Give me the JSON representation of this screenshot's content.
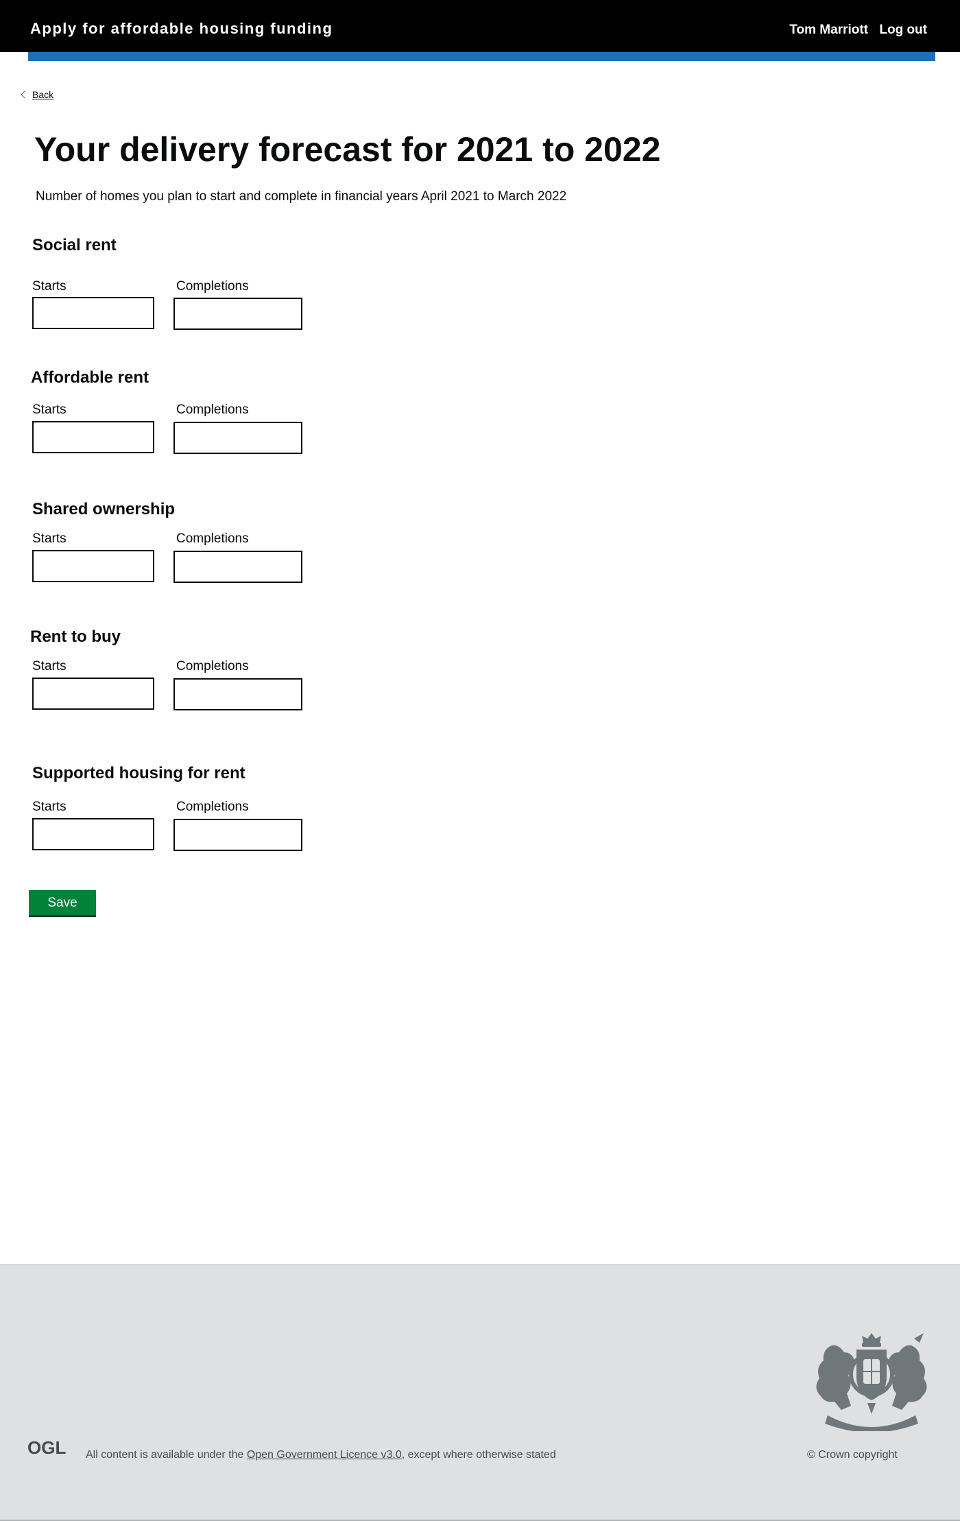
{
  "header": {
    "service_name": "Apply for affordable housing funding",
    "user_name": "Tom Marriott",
    "logout_label": "Log out",
    "bar_color": "#1d70b8"
  },
  "back_link": {
    "label": "Back",
    "icon": "chevron-left-icon"
  },
  "page": {
    "title": "Your delivery forecast for 2021 to 2022",
    "intro": "Number of homes you plan to start and complete in financial years April 2021 to March 2022"
  },
  "sections": [
    {
      "heading": "Social rent",
      "starts_label": "Starts",
      "starts_value": "",
      "completions_label": "Completions",
      "completions_value": ""
    },
    {
      "heading": "Affordable rent",
      "starts_label": "Starts",
      "starts_value": "",
      "completions_label": "Completions",
      "completions_value": ""
    },
    {
      "heading": "Shared ownership",
      "starts_label": "Starts",
      "starts_value": "",
      "completions_label": "Completions",
      "completions_value": ""
    },
    {
      "heading": "Rent to buy",
      "starts_label": "Starts",
      "starts_value": "",
      "completions_label": "Completions",
      "completions_value": ""
    },
    {
      "heading": "Supported housing for rent",
      "starts_label": "Starts",
      "starts_value": "",
      "completions_label": "Completions",
      "completions_value": ""
    }
  ],
  "save_button": {
    "label": "Save",
    "color": "#00823b"
  },
  "footer": {
    "ogl_logo": "OGL",
    "licence_prefix": "All content is available under the ",
    "licence_link": "Open Government Licence v3.0",
    "licence_suffix": ", except where otherwise stated",
    "copyright": "© Crown copyright",
    "crest_icon": "royal-coat-of-arms-icon"
  }
}
